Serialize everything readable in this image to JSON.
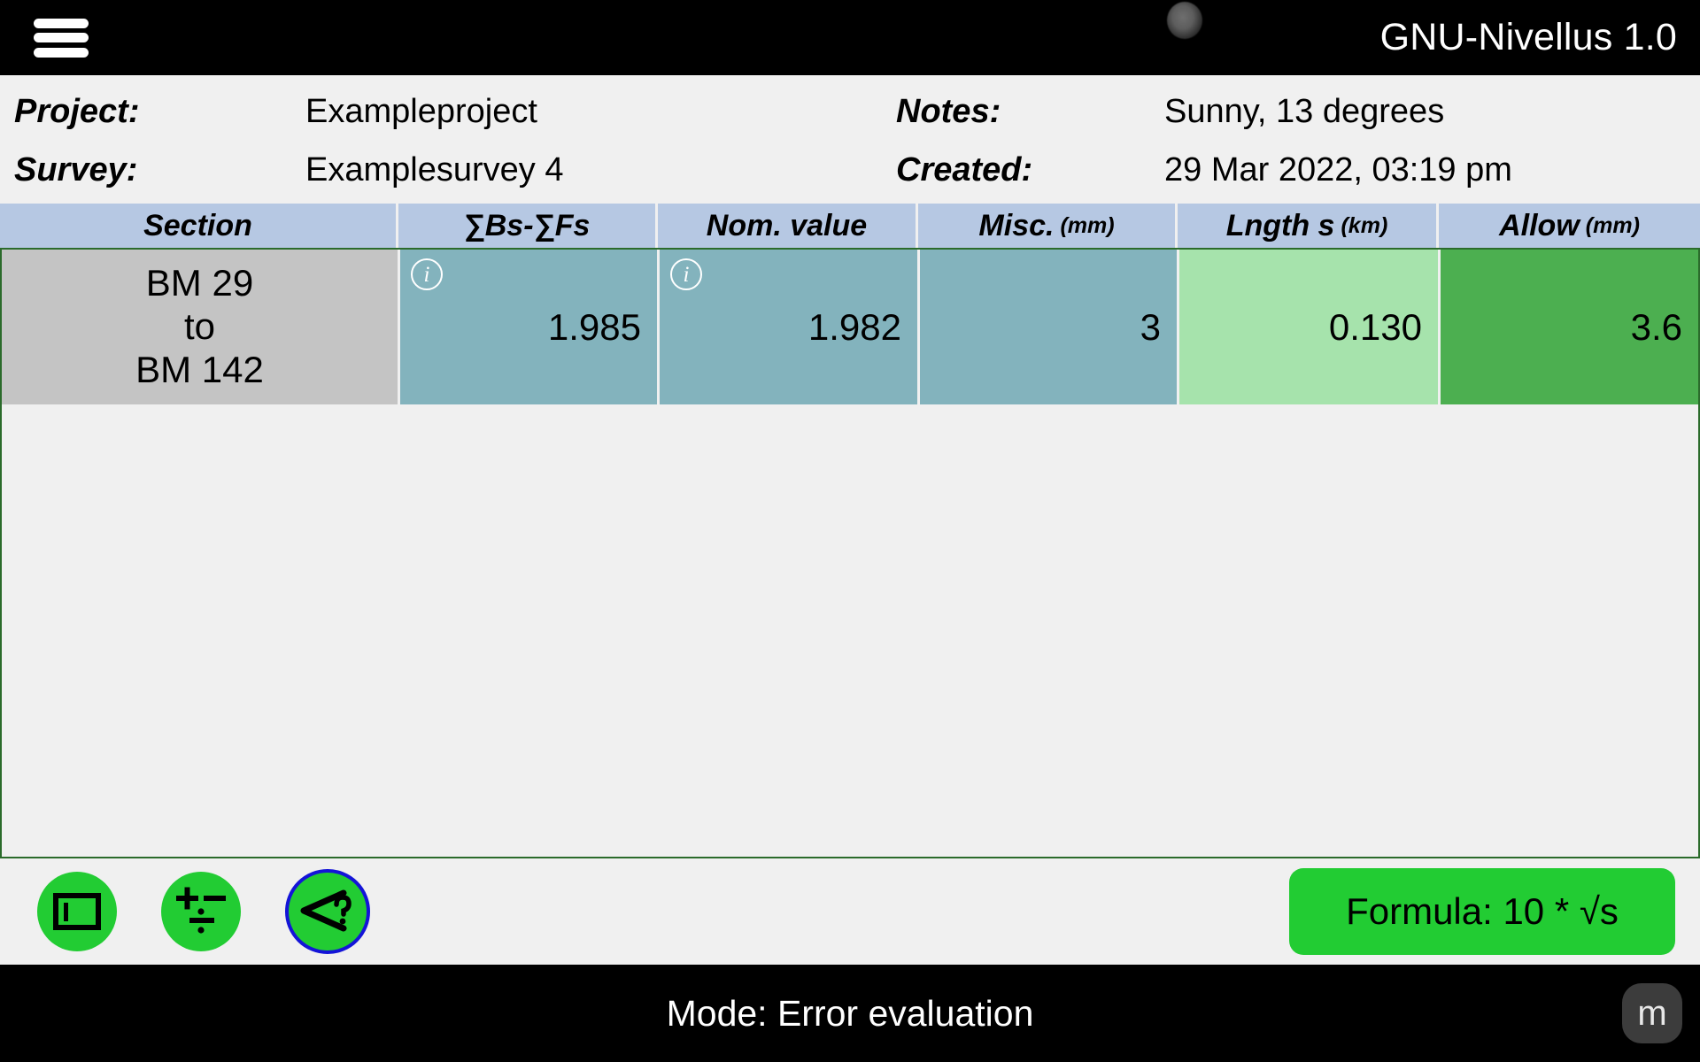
{
  "appbar": {
    "title": "GNU-Nivellus 1.0",
    "menu_icon": "hamburger-menu-icon",
    "notch_icon": "camera-lens-icon"
  },
  "meta": {
    "project_label": "Project:",
    "project_value": "Exampleproject",
    "survey_label": "Survey:",
    "survey_value": "Examplesurvey 4",
    "notes_label": "Notes:",
    "notes_value": "Sunny, 13 degrees",
    "created_label": "Created:",
    "created_value": "29 Mar 2022, 03:19 pm"
  },
  "table": {
    "columns": [
      {
        "label": "Section",
        "unit": ""
      },
      {
        "label": "∑Bs-∑Fs",
        "unit": ""
      },
      {
        "label": "Nom. value",
        "unit": ""
      },
      {
        "label": "Misc.",
        "unit": "(mm)"
      },
      {
        "label": "Lngth s",
        "unit": "(km)"
      },
      {
        "label": "Allow",
        "unit": "(mm)"
      }
    ],
    "rows": [
      {
        "section_from": "BM 29",
        "section_mid": "to",
        "section_to": "BM 142",
        "bs_fs": "1.985",
        "nom_value": "1.982",
        "misc": "3",
        "length": "0.130",
        "allow": "3.6",
        "bs_fs_has_info": true,
        "nom_value_has_info": true,
        "info_icon": "info-circle-icon"
      }
    ]
  },
  "actions": {
    "buttons": [
      {
        "name": "section-view-button",
        "icon": "rectangle-bar-icon"
      },
      {
        "name": "calculate-button",
        "icon": "plus-minus-divide-icon"
      },
      {
        "name": "tolerance-check-button",
        "icon": "less-than-question-icon"
      }
    ],
    "formula_label": "Formula: 10 * √s"
  },
  "statusbar": {
    "mode_text": "Mode: Error evaluation",
    "unit_badge": "m"
  },
  "colors": {
    "appbar_bg": "#000000",
    "page_bg": "#f0f0f0",
    "header_cell_bg": "#b6c8e3",
    "section_cell_bg": "#c4c4c4",
    "value_cell_bg": "#83b3bd",
    "length_cell_bg": "#a6e3ac",
    "allow_cell_bg": "#4caf50",
    "fab_green": "#22cc33",
    "fab_ring_blue": "#1414d8",
    "list_border_green": "#2b6b2b",
    "badge_bg": "#3c3c3c"
  }
}
